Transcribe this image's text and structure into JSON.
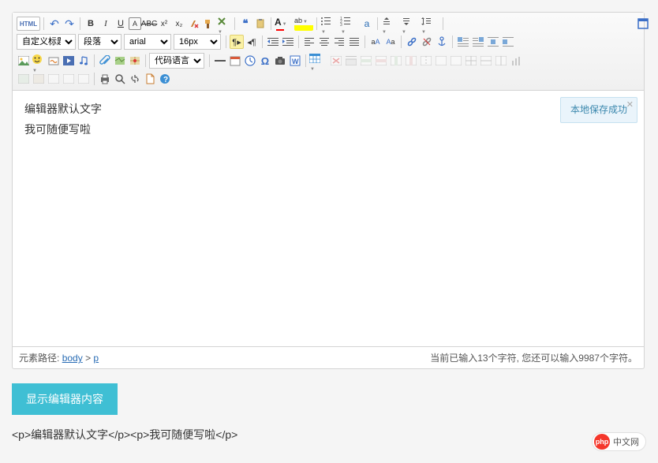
{
  "toolbar": {
    "html_label": "HTML",
    "undo": "↶",
    "redo": "↷",
    "bold": "B",
    "italic": "I",
    "underline": "U",
    "font_color": "A",
    "bg_color": "ab",
    "quote": "❝",
    "ltr": "¶",
    "rtl": "¶",
    "indent_l": "⇤",
    "indent_r": "⇥",
    "selects": {
      "custom_title": "自定义标题",
      "paragraph": "段落",
      "font_family": "arial",
      "font_size": "16px",
      "code_lang": "代码语言"
    }
  },
  "content": {
    "line1": "编辑器默认文字",
    "line2": "我可随便写啦"
  },
  "save_notice": "本地保存成功",
  "statusbar": {
    "path_label": "元素路径:",
    "path_body": "body",
    "path_sep": ">",
    "path_p": "p",
    "count_prefix": "当前已输入",
    "count_chars": "13",
    "count_mid": "个字符, 您还可以输入",
    "count_remain": "9987",
    "count_suffix": "个字符。"
  },
  "show_button": "显示编辑器内容",
  "output_html": "<p>编辑器默认文字</p><p>我可随便写啦</p>",
  "logo": {
    "badge": "php",
    "text": "中文网"
  }
}
